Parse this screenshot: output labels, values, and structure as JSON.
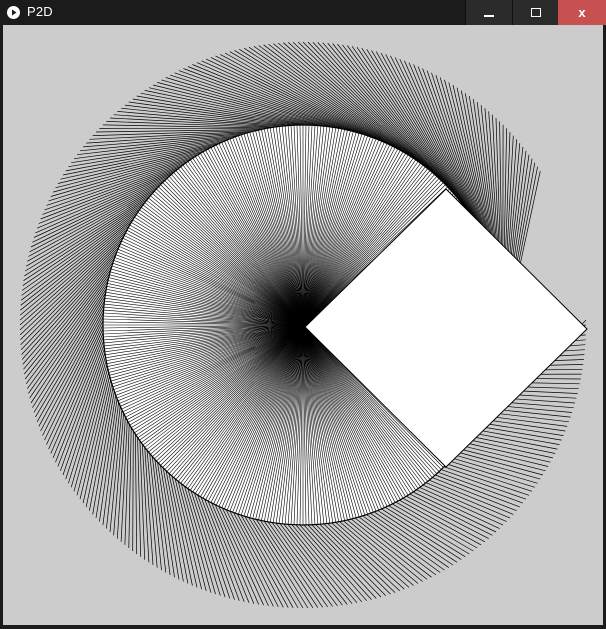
{
  "window": {
    "title": "P2D",
    "controls": {
      "minimize_icon": "minimize-icon",
      "maximize_icon": "maximize-icon",
      "close_label": "x"
    },
    "colors": {
      "titlebar": "#1b1b1b",
      "close": "#c75050"
    }
  },
  "sketch": {
    "background": "#cccccc",
    "stroke": "#000000",
    "fill": "#ffffff"
  }
}
